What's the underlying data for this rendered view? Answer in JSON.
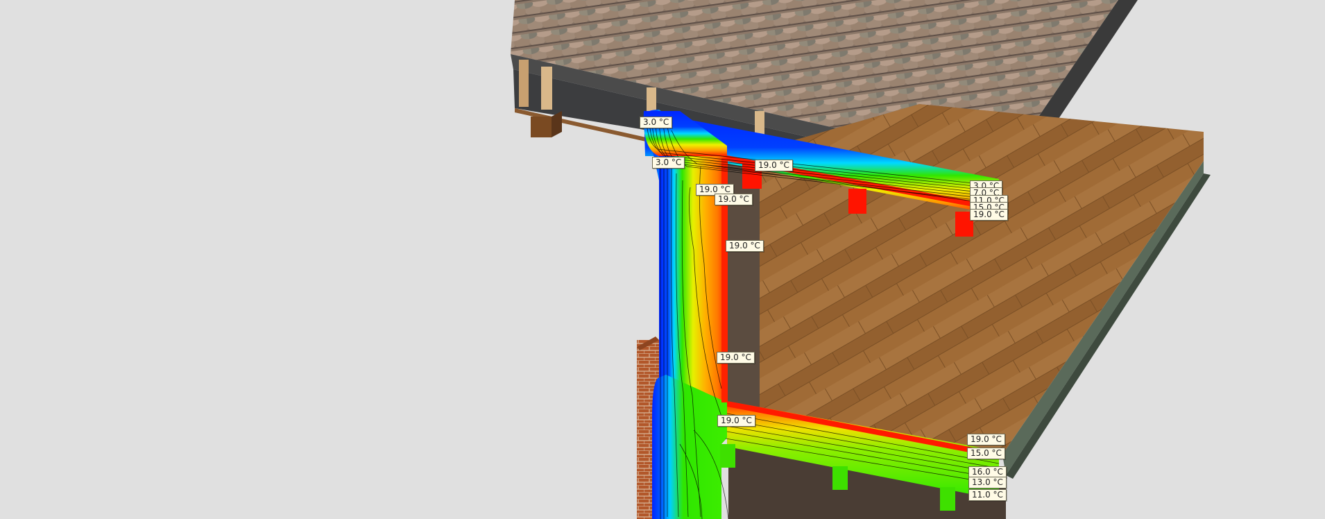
{
  "scene": {
    "description_free": true,
    "background_color": "#e0e0e0",
    "colors": {
      "cold": "#0033ff",
      "cool": "#00e5ff",
      "mid": "#36f000",
      "warm": "#ffee00",
      "hot": "#ff7a00",
      "interior": "#ff1a00",
      "roof_tile": "#8e7a6a",
      "wood_floor": "#a06a35",
      "brick": "#b55a2a",
      "slab_edge": "#5a6a5a"
    }
  },
  "labels": {
    "l01": "3.0 °C",
    "l02": "3.0 °C",
    "l03": "19.0 °C",
    "l04": "19.0 °C",
    "l05": "19.0 °C",
    "l06": "19.0 °C",
    "l07": "19.0 °C",
    "l08": "19.0 °C",
    "l09": "3.0 °C",
    "l10": "7.0 °C",
    "l11": "11.0 °C",
    "l12": "15.0 °C",
    "l13": "19.0 °C",
    "l14": "19.0 °C",
    "l15": "15.0 °C",
    "l16": "16.0 °C",
    "l17": "13.0 °C",
    "l18": "11.0 °C"
  }
}
